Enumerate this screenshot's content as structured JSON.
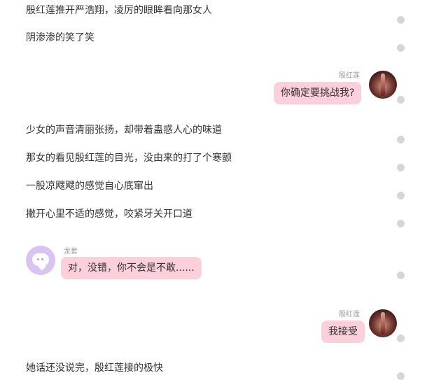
{
  "messages": {
    "narration": [
      "殷红莲推开严浩翔，凌厉的眼眸看向那女人",
      "阴渗渗的笑了笑",
      "少女的声音清丽张扬，却带着蛊惑人心的味道",
      "那女的看见殷红莲的目光，没由来的打了个寒颤",
      "一股凉飕飕的感觉自心底窜出",
      "撇开心里不适的感觉，咬紧牙关开口道",
      "她话还没说完，殷红莲接的极快"
    ],
    "dialogue": [
      {
        "speaker": "殷红莲",
        "text": "你确定要挑战我?"
      },
      {
        "speaker": "龙套",
        "text": "对，没错，你不会是不敢......"
      },
      {
        "speaker": "殷红莲",
        "text": "我接受"
      }
    ]
  },
  "icons": {
    "user_avatar": "character-avatar-photo",
    "bot_avatar": "chat-bubble-avatar",
    "message_status": "status-dot"
  },
  "colors": {
    "bubble": "#fbd0da",
    "bot_avatar": "#d9c3f2",
    "status_dot": "#d6d6d6",
    "speaker_name": "#999999"
  }
}
